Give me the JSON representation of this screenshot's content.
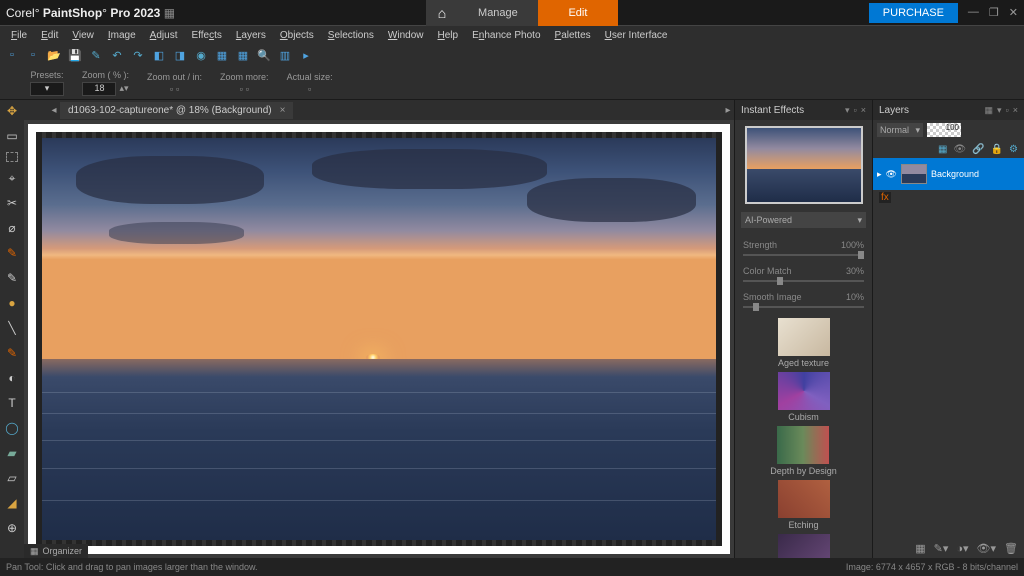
{
  "title": {
    "brand1": "Corel",
    "brand2": "PaintShop",
    "brand3": "Pro 2023"
  },
  "toptabs": {
    "manage": "Manage",
    "edit": "Edit"
  },
  "purchase": "PURCHASE",
  "menu": [
    "File",
    "Edit",
    "View",
    "Image",
    "Adjust",
    "Effects",
    "Layers",
    "Objects",
    "Selections",
    "Window",
    "Help",
    "Enhance Photo",
    "Palettes",
    "User Interface"
  ],
  "zoomBar": {
    "presets": "Presets:",
    "zoompct": "Zoom ( % ):",
    "zoomval": "18",
    "zoomout": "Zoom out / in:",
    "zoommore": "Zoom more:",
    "actual": "Actual size:"
  },
  "docTab": "d1063-102-captureone* @ 18% (Background)",
  "instantEffects": {
    "title": "Instant Effects",
    "category": "AI-Powered",
    "strength": {
      "label": "Strength",
      "val": "100%"
    },
    "colormatch": {
      "label": "Color Match",
      "val": "30%"
    },
    "smooth": {
      "label": "Smooth Image",
      "val": "10%"
    },
    "items": [
      "Aged texture",
      "Cubism",
      "Depth by Design",
      "Etching"
    ]
  },
  "layers": {
    "title": "Layers",
    "blend": "Normal",
    "opacity": "100",
    "bg": "Background"
  },
  "organizer": "Organizer",
  "status": {
    "left": "Pan Tool: Click and drag to pan images larger than the window.",
    "right": "Image:  6774 x 4657 x RGB - 8 bits/channel"
  }
}
